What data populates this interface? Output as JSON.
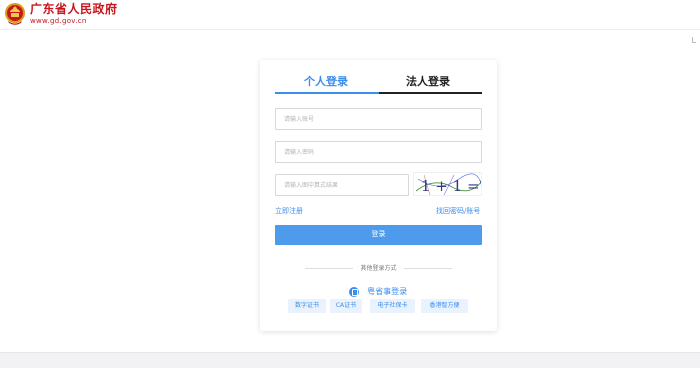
{
  "header": {
    "title": "广东省人民政府",
    "url": "www.gd.gov.cn",
    "brand_color": "#c8161d"
  },
  "login": {
    "tabs": [
      {
        "label": "个人登录",
        "active": true
      },
      {
        "label": "法人登录",
        "active": false
      }
    ],
    "account_placeholder": "请输入账号",
    "password_placeholder": "请输入密码",
    "captcha_placeholder": "请输入图中算式结果",
    "captcha_text": "1 + 1 =?",
    "register_link": "立即注册",
    "forgot_link": "找回密码/账号",
    "submit_label": "登录",
    "other_methods_label": "其他登录方式",
    "yss_label": "粤省事登录",
    "methods": [
      "数字证书",
      "CA证书",
      "电子社保卡",
      "香港智方便"
    ],
    "accent_color": "#3d8eea"
  }
}
